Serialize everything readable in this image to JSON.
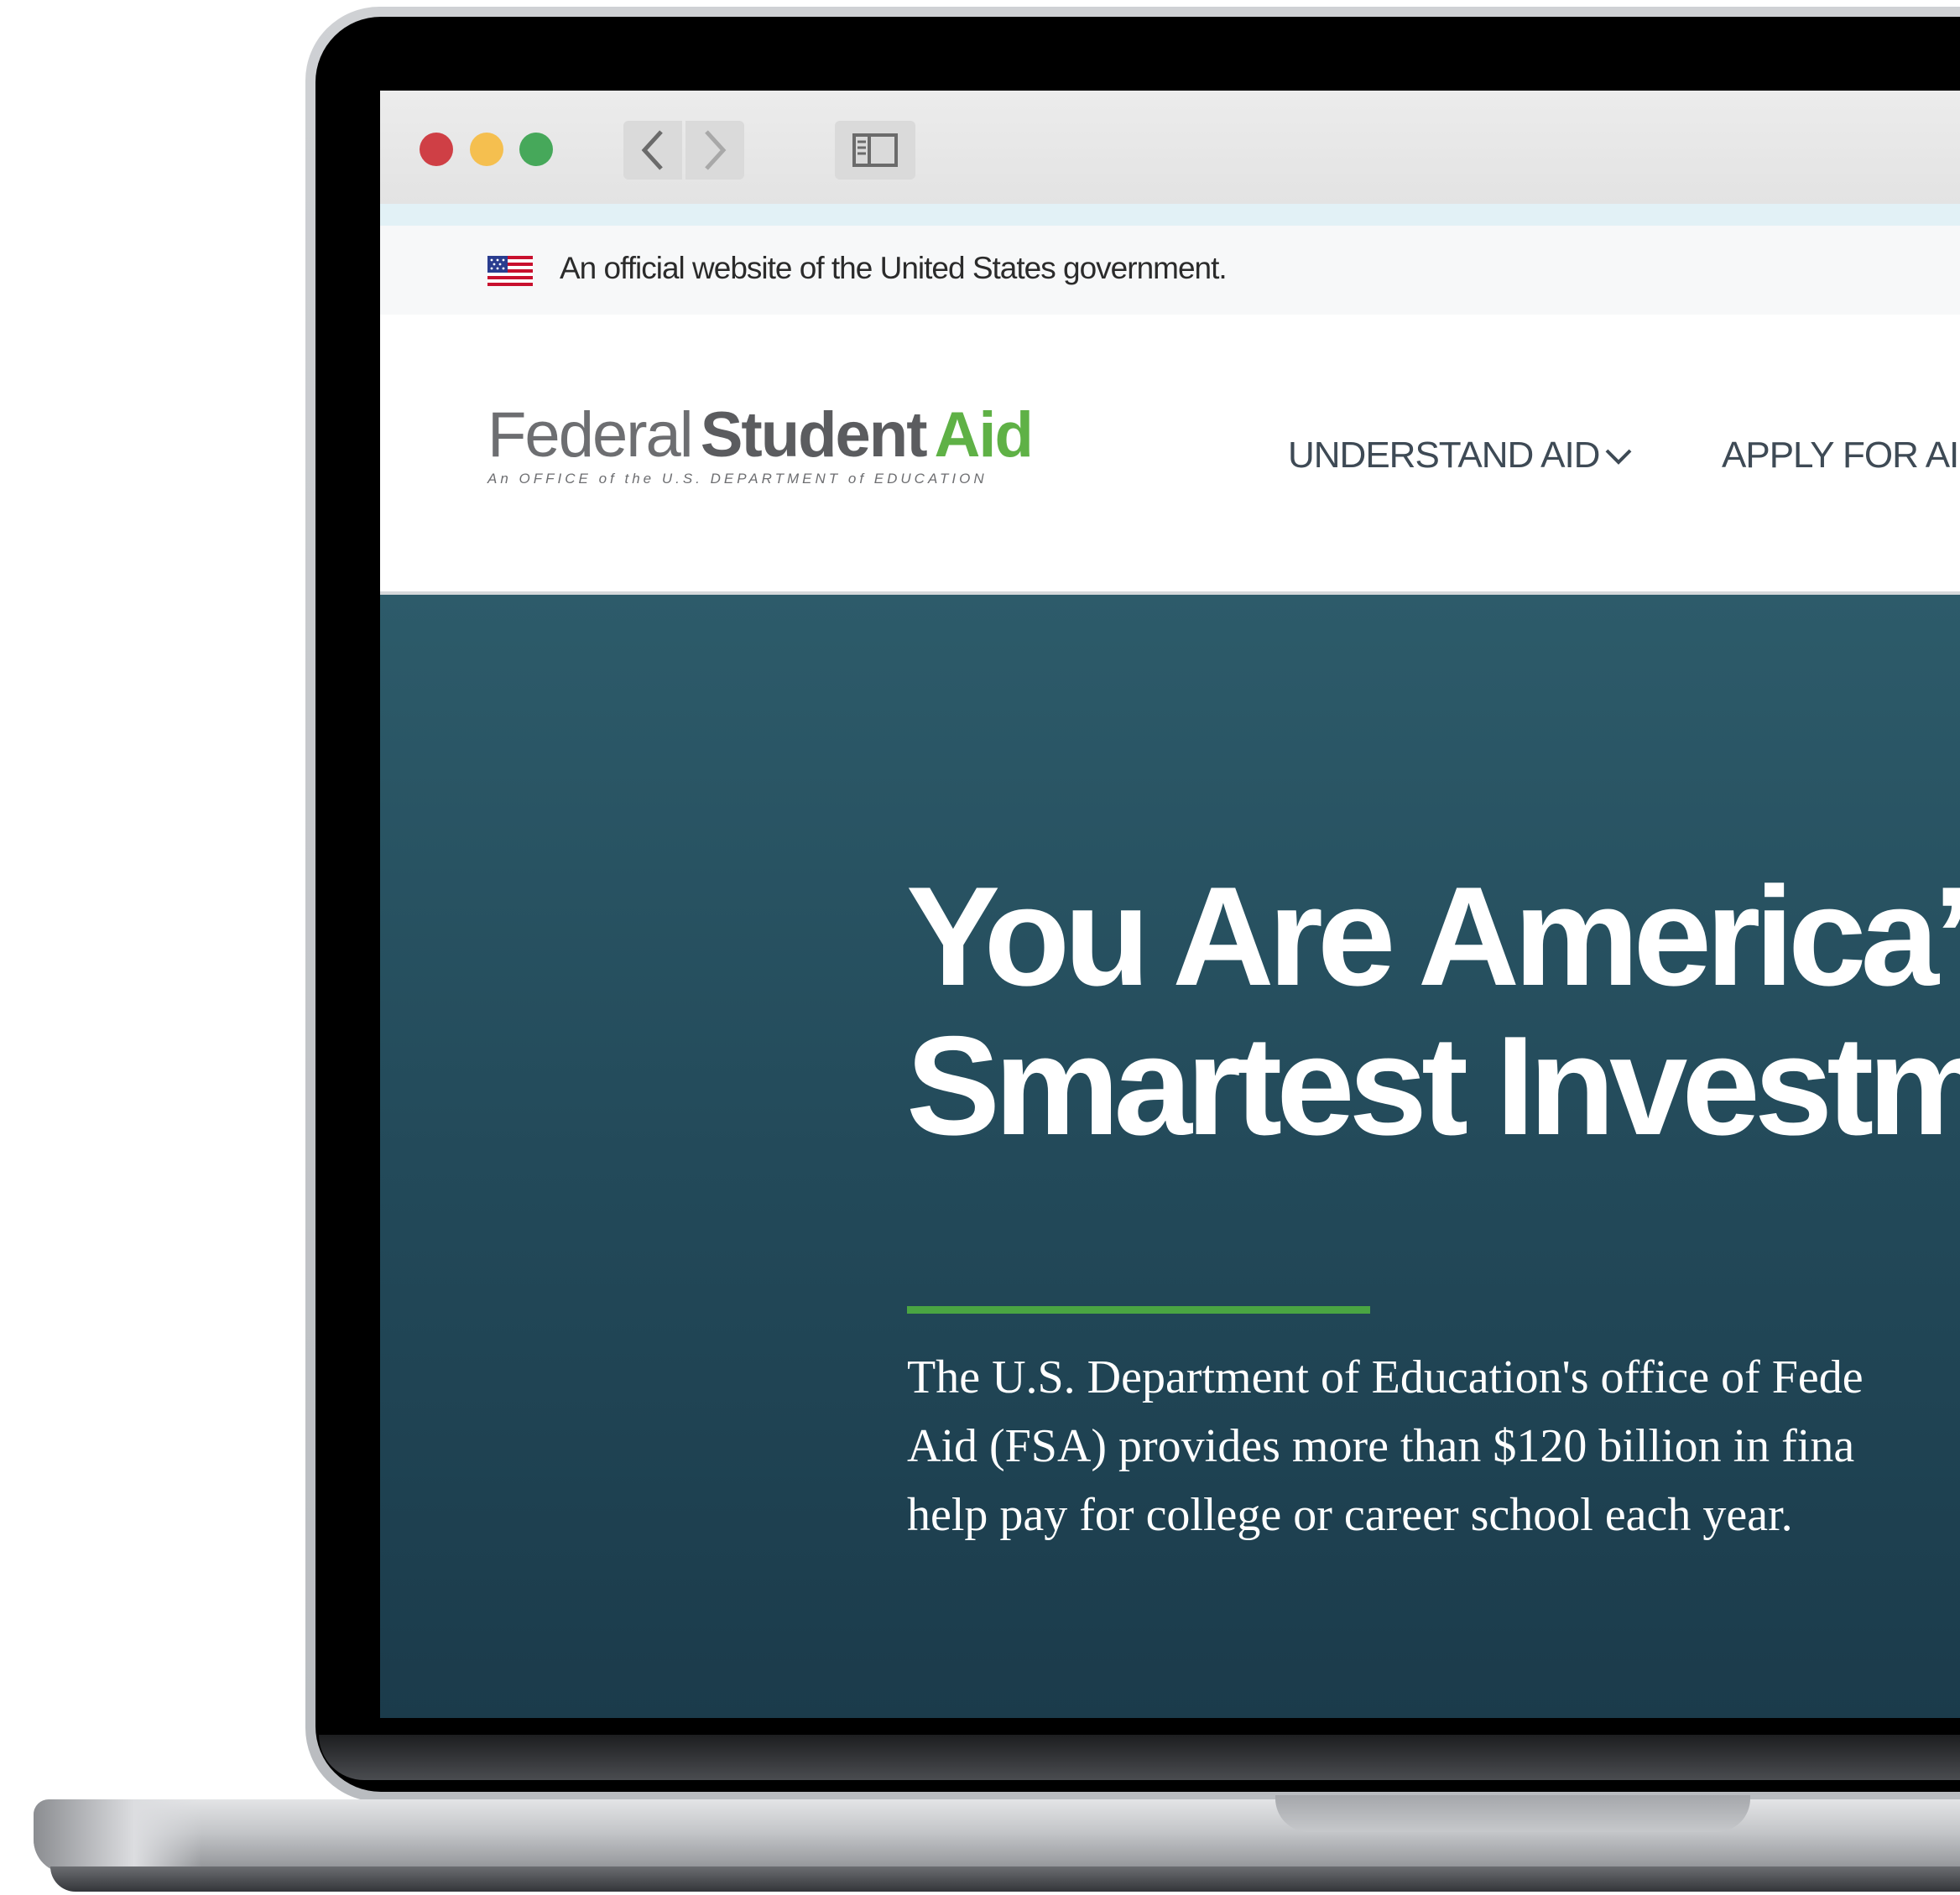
{
  "colors": {
    "hero_top": "#2d5b6a",
    "hero_bottom": "#1b3b4b",
    "accent_green": "#5fb146",
    "rule_green": "#4aa542",
    "nav_text": "#3e4a55"
  },
  "browser": {
    "traffic_lights": [
      "close",
      "minimize",
      "zoom"
    ],
    "back_icon": "chevron-left-icon",
    "forward_icon": "chevron-right-icon",
    "sidebar_icon": "sidebar-toggle-icon"
  },
  "gov_banner": {
    "flag_icon": "us-flag-icon",
    "text": "An official website of the United States government."
  },
  "header": {
    "logo": {
      "federal": "Federal",
      "student": "Student",
      "aid": "Aid",
      "subtitle": "An OFFICE of the U.S. DEPARTMENT of EDUCATION"
    },
    "nav": [
      {
        "label": "UNDERSTAND AID",
        "icon": "chevron-down-icon"
      },
      {
        "label": "APPLY FOR AID"
      }
    ]
  },
  "hero": {
    "title_line1": "You Are America’s",
    "title_line2": "Smartest Investme",
    "body_line1": "The U.S. Department of Education's office of Fede",
    "body_line2": "Aid (FSA) provides more than $120 billion in fina",
    "body_line3": "help pay for college or career school each year."
  }
}
